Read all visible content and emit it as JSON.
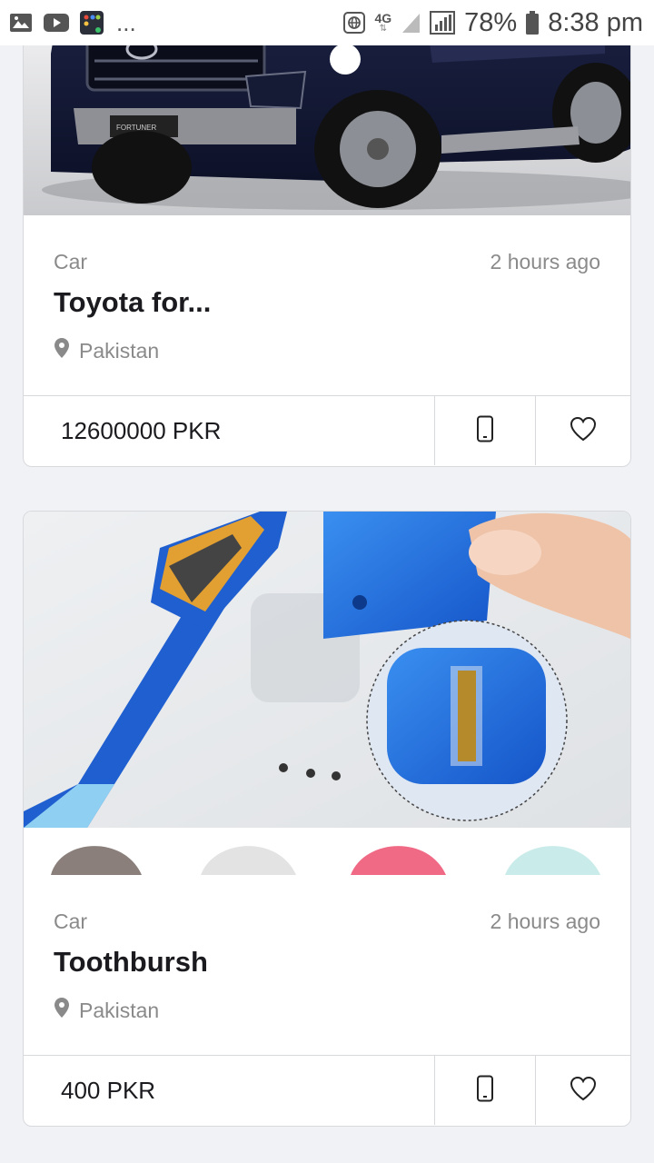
{
  "status_bar": {
    "battery": "78%",
    "time": "8:38 pm",
    "network": "4G",
    "more": "..."
  },
  "listings": [
    {
      "category": "Car",
      "time_ago": "2 hours ago",
      "title": "Toyota for...",
      "location": "Pakistan",
      "price": "12600000 PKR",
      "image_icon": "car-photo"
    },
    {
      "category": "Car",
      "time_ago": "2 hours ago",
      "title": "Toothbursh",
      "location": "Pakistan",
      "price": "400 PKR",
      "image_icon": "toothbrush-photo"
    }
  ]
}
